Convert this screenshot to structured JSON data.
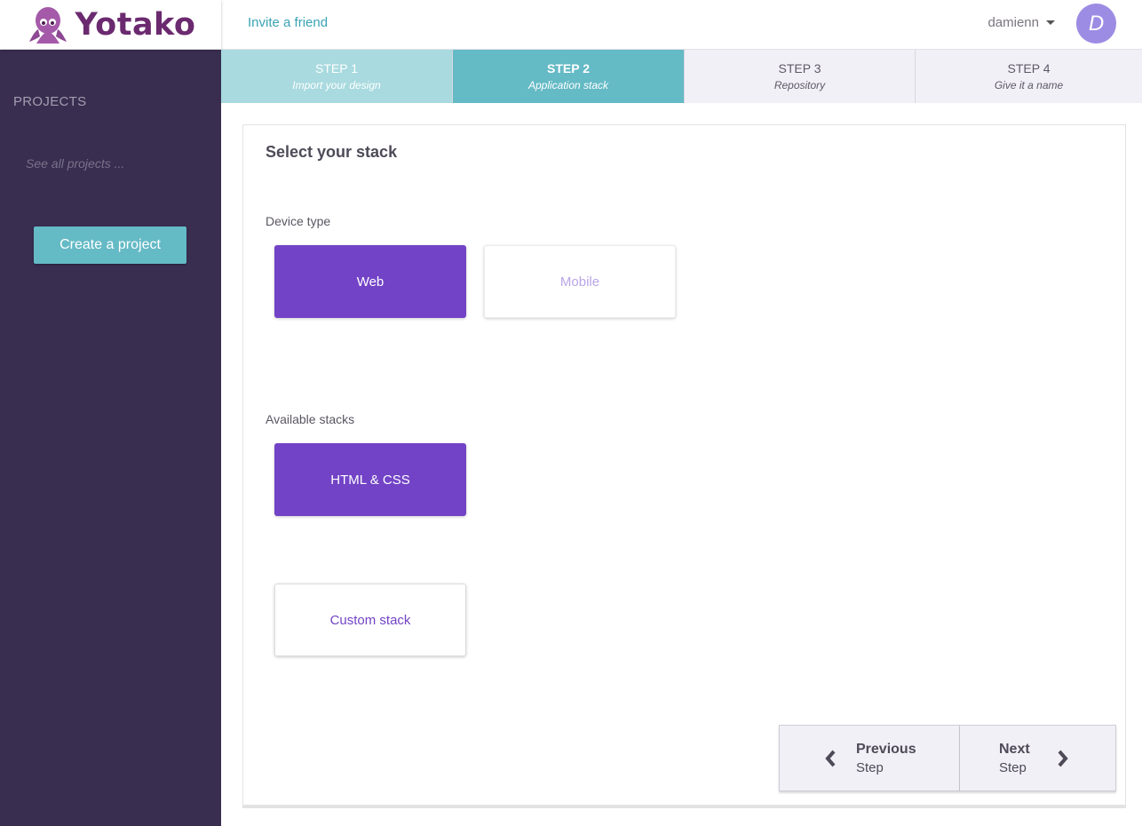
{
  "app": {
    "name": "Yotako"
  },
  "header": {
    "invite_label": "Invite a friend",
    "username": "damienn",
    "avatar_letter": "D"
  },
  "sidebar": {
    "section_label": "PROJECTS",
    "see_all_label": "See all projects ...",
    "create_button_label": "Create a project"
  },
  "steps": [
    {
      "num": "STEP 1",
      "label": "Import your design",
      "state": "done"
    },
    {
      "num": "STEP 2",
      "label": "Application stack",
      "state": "active"
    },
    {
      "num": "STEP 3",
      "label": "Repository",
      "state": "todo"
    },
    {
      "num": "STEP 4",
      "label": "Give it a name",
      "state": "todo"
    }
  ],
  "main": {
    "title": "Select your stack",
    "device_type": {
      "label": "Device type",
      "options": [
        {
          "label": "Web",
          "selected": true
        },
        {
          "label": "Mobile",
          "selected": false
        }
      ]
    },
    "stacks": {
      "label": "Available stacks",
      "options": [
        {
          "label": "HTML & CSS",
          "selected": true
        },
        {
          "label": "Custom stack",
          "selected": false
        }
      ]
    },
    "nav": {
      "prev_title": "Previous",
      "prev_sub": "Step",
      "next_title": "Next",
      "next_sub": "Step"
    }
  },
  "colors": {
    "accent_purple": "#7243c6",
    "teal": "#64bac5",
    "sidebar_bg": "#392d50",
    "mobile_text": "#b9a5e6",
    "custom_text": "#7243c6"
  }
}
